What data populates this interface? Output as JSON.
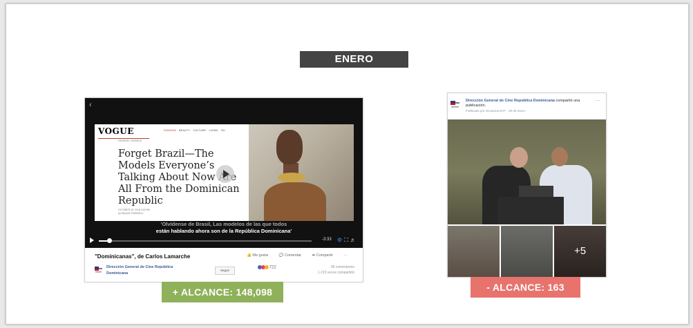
{
  "banner": {
    "title": "ENERO"
  },
  "left_post": {
    "vogue_logo": "VOGUE",
    "vogue_nav": [
      "FASHION",
      "BEAUTY",
      "CULTURE",
      "LIVING",
      "RU"
    ],
    "vogue_section": "FASHION > MODELS",
    "headline": "Forget Brazil—The Models Everyone’s Talking About Now Are All From the Dominican Republic",
    "byline_1": "OCTOBER 16, 2018 3:15 PM",
    "byline_2": "by ANIQUE SWINDELL",
    "caption_line1": "'Olvídense de Brasil, Las modelos de las que todos",
    "caption_line2": "están hablando ahora son de la República Dominicana'",
    "video_time": "-3:33",
    "video_progress": 0.05,
    "post_title": "\"Dominicanas\", de Carlos Lamarche",
    "actions": [
      "Me gusta",
      "Comentar",
      "Compartir"
    ],
    "page_name": "Dirección General de Cine República Dominicana",
    "follow_label": "Seguir",
    "reactions_count": "722",
    "comments": "96 comentarios",
    "shares": "1.215 veces compartido",
    "reach_label": "+  ALCANCE: 148,098"
  },
  "right_post": {
    "page_name": "Dirección General de Cine República Dominicana",
    "shared_text": "compartió una publicación.",
    "meta": "Publicado por Giovanna M.P. · 29 de enero ·",
    "more_photos": "+5",
    "reach_label": "- ALCANCE: 163"
  },
  "colors": {
    "banner": "#444444",
    "positive": "#8fb15a",
    "negative": "#e8736d",
    "fb_link": "#385898"
  }
}
